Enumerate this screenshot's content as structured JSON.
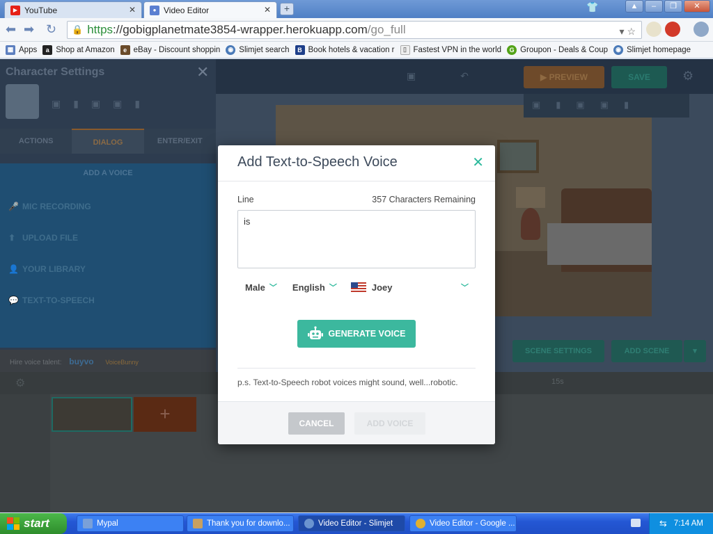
{
  "browser": {
    "tabs": [
      {
        "label": "YouTube",
        "active": false
      },
      {
        "label": "Video Editor",
        "active": true
      }
    ],
    "url": {
      "scheme": "https",
      "host": "://gobigplanetmate3854-wrapper.herokuapp.com",
      "path": "/go_full"
    },
    "bookmarks": [
      {
        "label": "Apps",
        "icon": "apps-grid-icon"
      },
      {
        "label": "Shop at Amazon",
        "icon": "amazon-icon"
      },
      {
        "label": "eBay - Discount shoppin",
        "icon": "ebay-icon"
      },
      {
        "label": "Slimjet search",
        "icon": "slimjet-icon"
      },
      {
        "label": "Book hotels & vacation r",
        "icon": "booking-icon"
      },
      {
        "label": "Fastest VPN in the world",
        "icon": "page-icon"
      },
      {
        "label": "Groupon - Deals & Coup",
        "icon": "groupon-icon"
      },
      {
        "label": "Slimjet homepage",
        "icon": "slimjet-icon"
      }
    ]
  },
  "app": {
    "left_panel": {
      "title": "Character Settings",
      "tabs": [
        "ACTIONS",
        "DIALOG",
        "ENTER/EXIT"
      ],
      "voice_header": "ADD A VOICE",
      "voice_options": [
        "MIC RECORDING",
        "UPLOAD FILE",
        "YOUR LIBRARY",
        "TEXT-TO-SPEECH"
      ],
      "hire_text": "Hire voice talent:",
      "hire_brands": [
        "buyvo",
        "VoiceBunny"
      ]
    },
    "top_bar": {
      "preview_label": "PREVIEW",
      "save_label": "SAVE"
    },
    "scene": {
      "scene_settings_label": "SCENE SETTINGS",
      "add_scene_label": "ADD SCENE"
    },
    "timeline": {
      "time_label": "15s",
      "add_symbol": "+"
    }
  },
  "modal": {
    "title": "Add Text-to-Speech Voice",
    "line_label": "Line",
    "remaining": "357 Characters Remaining",
    "line_value": "is",
    "gender": "Male",
    "language": "English",
    "voice": "Joey",
    "generate_label": "GENERATE VOICE",
    "note": "p.s. Text-to-Speech robot voices might sound, well...robotic.",
    "cancel_label": "CANCEL",
    "add_label": "ADD VOICE",
    "accent_color": "#3cb89e"
  },
  "taskbar": {
    "start_label": "start",
    "tasks": [
      {
        "label": "Mypal",
        "active": false
      },
      {
        "label": "Thank you for downlo...",
        "active": false
      },
      {
        "label": "Video Editor - Slimjet",
        "active": true
      },
      {
        "label": "Video Editor - Google ...",
        "active": false
      }
    ],
    "clock": "7:14 AM"
  }
}
